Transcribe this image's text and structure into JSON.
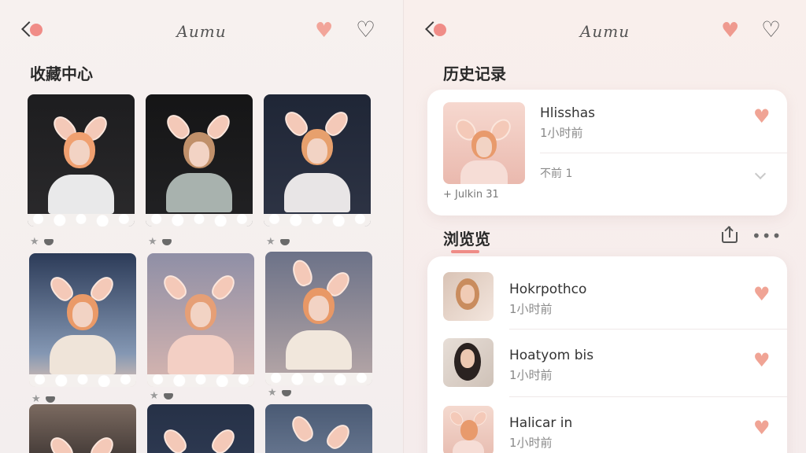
{
  "left": {
    "header": {
      "title": "Aumu"
    },
    "section_title": "收藏中心"
  },
  "right": {
    "header": {
      "title": "Aumu"
    },
    "history": {
      "title": "历史记录",
      "item_title": "Hlisshas",
      "item_time": "1小时前",
      "item_sub": "不前 1",
      "item_caption": "+ Julkin 31"
    },
    "browse": {
      "title": "浏览览",
      "items": [
        {
          "name": "Hokrpothco",
          "time": "1小时前"
        },
        {
          "name": "Hoatyom bis",
          "time": "1小时前"
        },
        {
          "name": "Halicar in",
          "time": "1小时前"
        }
      ]
    }
  },
  "colors": {
    "accent": "#f2a59a",
    "heart": "#f0a495"
  },
  "icons": {
    "back": "chevron-left-icon",
    "heart_filled": "heart-filled-icon",
    "heart_outline": "heart-outline-icon",
    "share": "share-icon",
    "more": "more-icon",
    "chevron_down": "chevron-down-icon",
    "star": "star-icon"
  }
}
